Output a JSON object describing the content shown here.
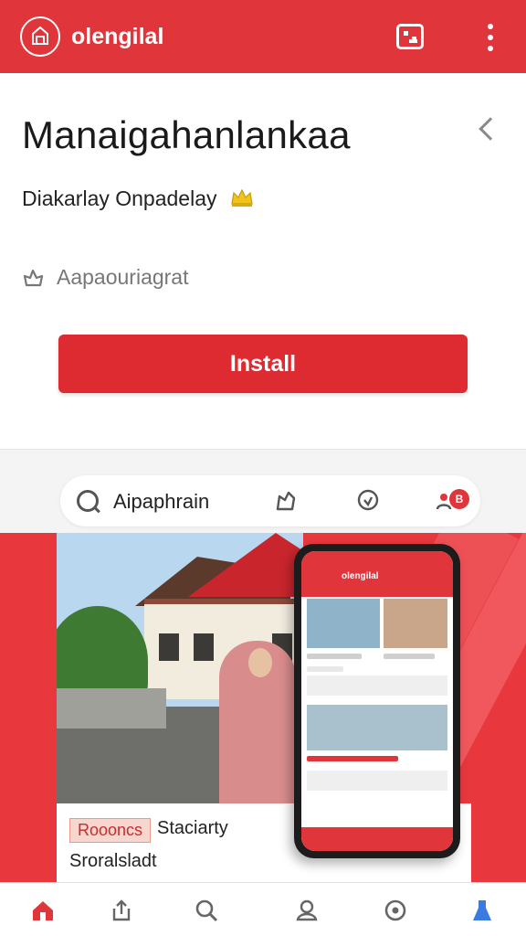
{
  "header": {
    "app_name": "olengilal"
  },
  "app": {
    "title": "Manaigahanlankaa",
    "subtitle": "Diakarlay Onpadelay",
    "meta": "Aapaouriagrat",
    "install_label": "Install"
  },
  "search": {
    "text": "Aipaphrain",
    "badge": "B"
  },
  "promo": {
    "tag": "Roooncs",
    "caption1": "Staciarty",
    "caption2": "Sroralsladt"
  },
  "colors": {
    "accent": "#e0353b",
    "button": "#de2b31"
  },
  "icons": [
    "logo-icon",
    "gallery-icon",
    "more-icon",
    "chevron-left-icon",
    "crown-icon",
    "settings-icon",
    "search-icon",
    "bookmark-icon",
    "location-icon",
    "profile-icon",
    "home-icon",
    "share-icon",
    "search-nav-icon",
    "people-icon",
    "explore-icon",
    "flask-icon"
  ]
}
